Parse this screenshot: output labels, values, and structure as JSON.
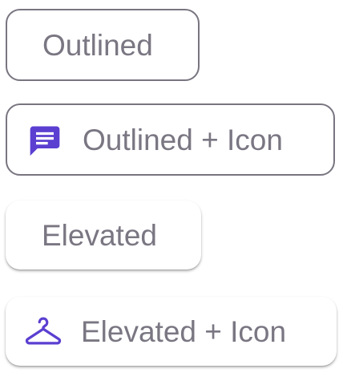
{
  "chips": {
    "outlined": {
      "label": "Outlined"
    },
    "outlined_icon": {
      "label": "Outlined + Icon",
      "icon": "message-icon"
    },
    "elevated": {
      "label": "Elevated"
    },
    "elevated_icon": {
      "label": "Elevated + Icon",
      "icon": "hanger-icon"
    }
  },
  "colors": {
    "label": "#7a7682",
    "outline": "#797580",
    "icon_accent": "#5b3fd1",
    "background": "#ffffff"
  }
}
